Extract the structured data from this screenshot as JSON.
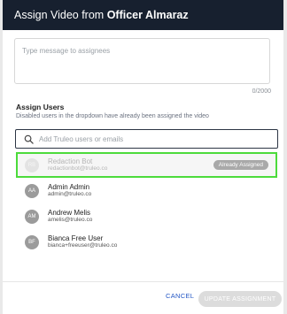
{
  "header": {
    "title_prefix": "Assign Video from",
    "officer_name": "Officer Almaraz"
  },
  "message": {
    "placeholder": "Type message to assignees",
    "value": "",
    "char_count": "0/2000"
  },
  "assign_users": {
    "title": "Assign Users",
    "subtitle": "Disabled users in the dropdown have already been assigned the video"
  },
  "search": {
    "placeholder": "Add Truleo users or emails",
    "value": "",
    "icon": "search-icon"
  },
  "users": [
    {
      "initials": "RB",
      "name": "Redaction Bot",
      "email": "redactionbot@truleo.co",
      "disabled": true,
      "badge": "Already Assigned"
    },
    {
      "initials": "AA",
      "name": "Admin Admin",
      "email": "admin@truleo.co",
      "disabled": false
    },
    {
      "initials": "AM",
      "name": "Andrew Melis",
      "email": "amelis@truleo.co",
      "disabled": false
    },
    {
      "initials": "BF",
      "name": "Bianca Free User",
      "email": "bianca+freeuser@truleo.co",
      "disabled": false
    }
  ],
  "footer": {
    "cancel_label": "CANCEL",
    "update_label": "UPDATE ASSIGNMENT"
  },
  "colors": {
    "header_bg": "#17202f",
    "highlight_border": "#4cdb3b",
    "link": "#2457c5",
    "avatar": "#9b9b9b",
    "badge": "#a9a9a9"
  }
}
